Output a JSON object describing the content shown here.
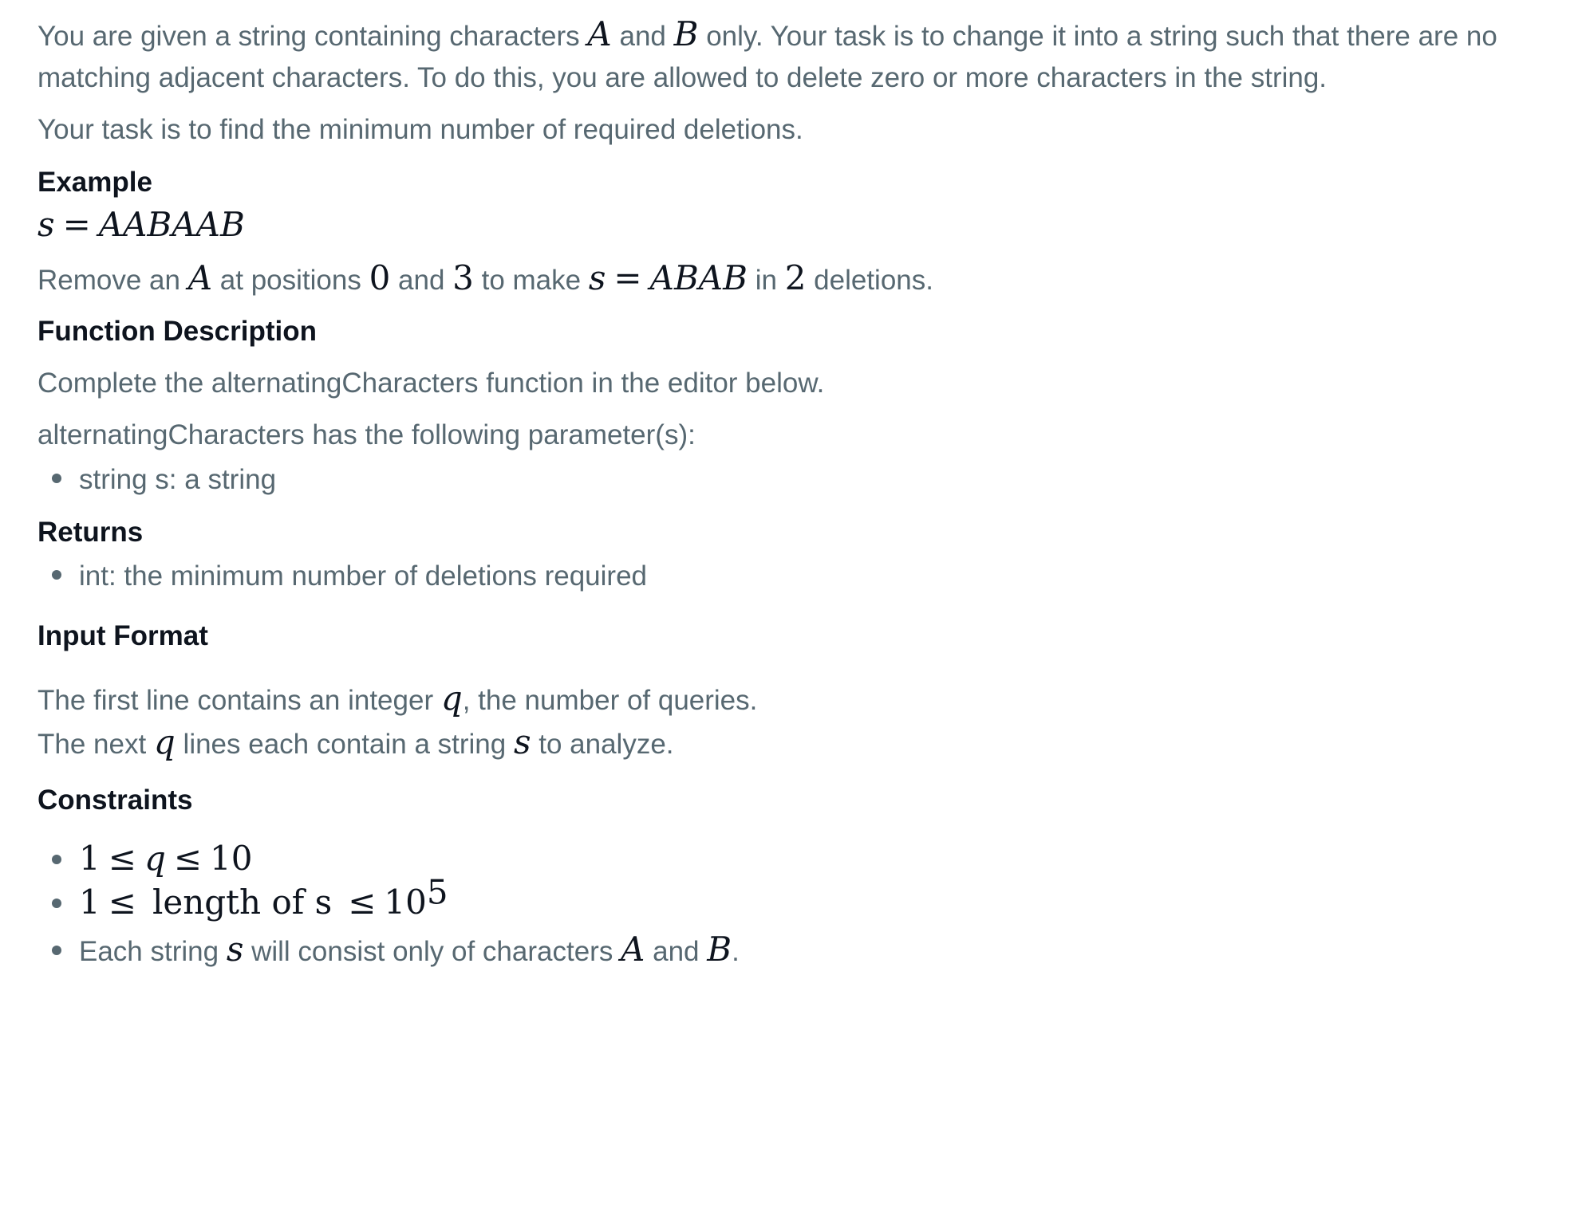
{
  "intro": {
    "p1a": "You are given a string containing characters ",
    "var_a": "A",
    "and": " and ",
    "var_b": "B",
    "p1b": " only. Your task is to change it into a string such that there are no",
    "p1c": "matching adjacent characters. To do this, you are allowed to delete zero or more characters in the string.",
    "p2": "Your task is to find the minimum number of required deletions."
  },
  "example": {
    "heading": "Example",
    "s_var": "s",
    "eq": "=",
    "s_value": "AABAAB",
    "remove_1": "Remove an ",
    "remove_a": "A",
    "remove_2": " at positions ",
    "pos_0": "0",
    "remove_3": " and ",
    "pos_3": "3",
    "remove_4": " to make ",
    "s_var2": "s",
    "eq2": "=",
    "result": "ABAB",
    "remove_5": " in ",
    "count": "2",
    "remove_6": " deletions."
  },
  "function_description": {
    "heading": "Function Description",
    "complete": "Complete the alternatingCharacters function in the editor below.",
    "params_intro": "alternatingCharacters has the following parameter(s):",
    "param_1": "string s: a string"
  },
  "returns": {
    "heading": "Returns",
    "item_1": "int: the minimum number of deletions required"
  },
  "input_format": {
    "heading": "Input Format",
    "l1a": "The first line contains an integer ",
    "q": "q",
    "l1b": ", the number of queries.",
    "l2a": "The next ",
    "q2": "q",
    "l2b": " lines each contain a string ",
    "s": "s",
    "l2c": " to analyze."
  },
  "constraints": {
    "heading": "Constraints",
    "c1_lo": "1",
    "c1_le1": "≤",
    "c1_var": "q",
    "c1_le2": "≤",
    "c1_hi": "10",
    "c2_lo": "1",
    "c2_le1": "≤",
    "c2_text": "length of s",
    "c2_le2": "≤",
    "c2_base": "10",
    "c2_exp": "5",
    "c3a": "Each string ",
    "c3_s": "s",
    "c3b": " will consist only of characters ",
    "c3_a": "A",
    "c3_and": " and ",
    "c3_b": "B",
    "c3_end": "."
  }
}
